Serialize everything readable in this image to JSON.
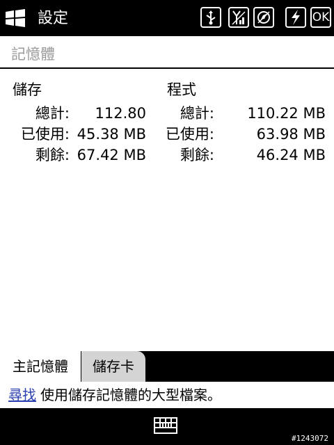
{
  "titlebar": {
    "title": "設定",
    "ok_label": "OK"
  },
  "section": {
    "header": "記憶體"
  },
  "storage": {
    "title": "儲存",
    "rows": [
      {
        "label": "總計:",
        "value": "112.80"
      },
      {
        "label": "已使用:",
        "value": "45.38 MB"
      },
      {
        "label": "剩餘:",
        "value": "67.42 MB"
      }
    ]
  },
  "program": {
    "title": "程式",
    "rows": [
      {
        "label": "總計:",
        "value": "110.22 MB"
      },
      {
        "label": "已使用:",
        "value": "63.98 MB"
      },
      {
        "label": "剩餘:",
        "value": "46.24 MB"
      }
    ]
  },
  "tabs": [
    {
      "label": "主記憶體",
      "selected": true
    },
    {
      "label": "儲存卡",
      "selected": false
    }
  ],
  "info": {
    "link_text": "尋找",
    "text": "使用儲存記憶體的大型檔案。"
  },
  "footer": {
    "build_text": "#1243072"
  },
  "icons": [
    "windows-logo-icon",
    "usb-icon",
    "signal-icon",
    "volume-icon",
    "power-icon",
    "keyboard-icon"
  ]
}
